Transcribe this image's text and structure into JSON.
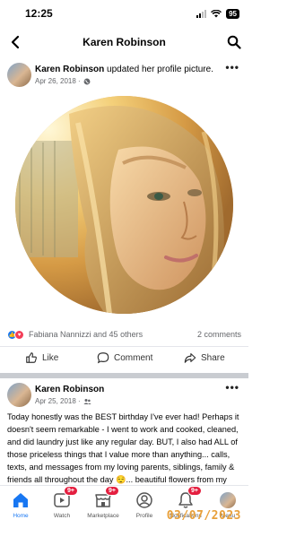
{
  "status_bar": {
    "time": "12:25",
    "battery": "95"
  },
  "header": {
    "title": "Karen Robinson",
    "back_icon": "back-arrow-icon",
    "search_icon": "search-icon"
  },
  "post1": {
    "author": "Karen Robinson",
    "action": "updated her profile picture.",
    "date": "Apr 26, 2018 ·",
    "privacy_icon": "globe-icon",
    "reactors": "Fabiana Nannizzi and 45 others",
    "comments": "2 comments",
    "actions": {
      "like": "Like",
      "comment": "Comment",
      "share": "Share"
    }
  },
  "post2": {
    "author": "Karen Robinson",
    "date": "Apr 25, 2018 ·",
    "privacy_icon": "friends-icon",
    "text": "Today honestly was the BEST birthday I've ever had! Perhaps it doesn't seem remarkable - I went to work and cooked, cleaned, and did laundry just like any regular day. BUT, I also had ALL of those priceless things that I value more than anything... calls, texts, and messages from my loving parents, siblings, family & friends all throughout the day 😌... beautiful flowers from my wonderful, caring"
  },
  "bottom_nav": {
    "items": [
      {
        "label": "Home",
        "icon": "home-icon",
        "badge": ""
      },
      {
        "label": "Watch",
        "icon": "watch-icon",
        "badge": "9+"
      },
      {
        "label": "Marketplace",
        "icon": "marketplace-icon",
        "badge": "9+"
      },
      {
        "label": "Profile",
        "icon": "profile-icon",
        "badge": ""
      },
      {
        "label": "Notifications",
        "icon": "bell-icon",
        "badge": "9+"
      },
      {
        "label": "Menu",
        "icon": "menu-icon",
        "badge": ""
      }
    ]
  },
  "date_stamp": "03/07/2023",
  "colors": {
    "accent": "#1877f2",
    "badge": "#e41e3f",
    "stamp": "#e8a03a"
  }
}
